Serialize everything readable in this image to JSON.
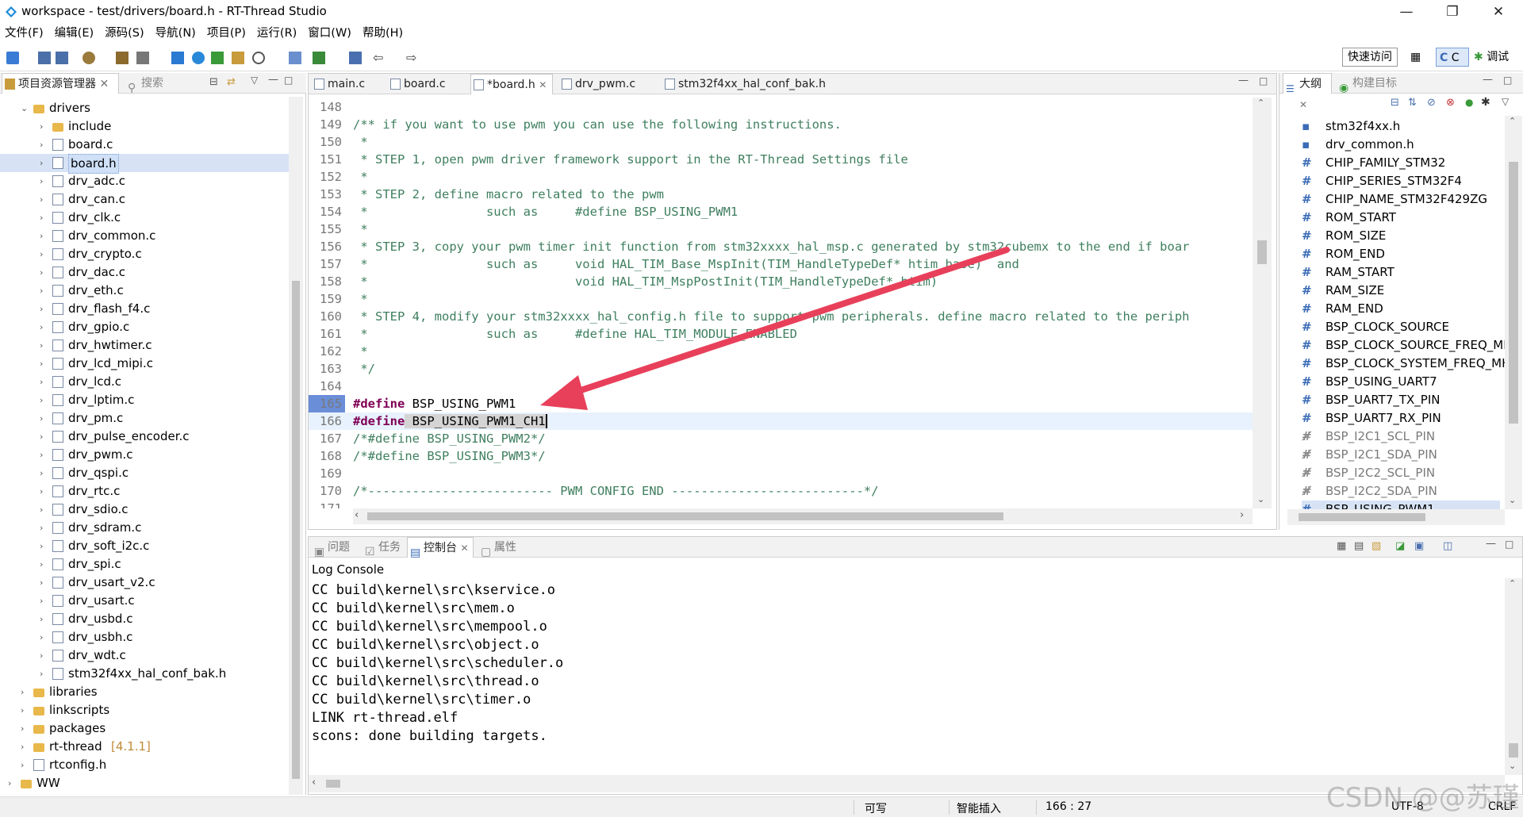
{
  "window": {
    "title": "workspace - test/drivers/board.h - RT-Thread Studio"
  },
  "menu": [
    "文件(F)",
    "编辑(E)",
    "源码(S)",
    "导航(N)",
    "项目(P)",
    "运行(R)",
    "窗口(W)",
    "帮助(H)"
  ],
  "toolbar": {
    "quick_access": "快速访问",
    "perspective_c": "C",
    "perspective_debug": "调试"
  },
  "explorer": {
    "tabs": [
      "项目资源管理器",
      "搜索"
    ],
    "items": [
      {
        "label": "drivers",
        "type": "folder",
        "expanded": true
      },
      {
        "label": "include",
        "type": "folder"
      },
      {
        "label": "board.c",
        "type": "file"
      },
      {
        "label": "board.h",
        "type": "file",
        "selected": true
      },
      {
        "label": "drv_adc.c",
        "type": "file"
      },
      {
        "label": "drv_can.c",
        "type": "file"
      },
      {
        "label": "drv_clk.c",
        "type": "file"
      },
      {
        "label": "drv_common.c",
        "type": "file"
      },
      {
        "label": "drv_crypto.c",
        "type": "file"
      },
      {
        "label": "drv_dac.c",
        "type": "file"
      },
      {
        "label": "drv_eth.c",
        "type": "file"
      },
      {
        "label": "drv_flash_f4.c",
        "type": "file"
      },
      {
        "label": "drv_gpio.c",
        "type": "file"
      },
      {
        "label": "drv_hwtimer.c",
        "type": "file"
      },
      {
        "label": "drv_lcd_mipi.c",
        "type": "file"
      },
      {
        "label": "drv_lcd.c",
        "type": "file"
      },
      {
        "label": "drv_lptim.c",
        "type": "file"
      },
      {
        "label": "drv_pm.c",
        "type": "file"
      },
      {
        "label": "drv_pulse_encoder.c",
        "type": "file"
      },
      {
        "label": "drv_pwm.c",
        "type": "file"
      },
      {
        "label": "drv_qspi.c",
        "type": "file"
      },
      {
        "label": "drv_rtc.c",
        "type": "file"
      },
      {
        "label": "drv_sdio.c",
        "type": "file"
      },
      {
        "label": "drv_sdram.c",
        "type": "file"
      },
      {
        "label": "drv_soft_i2c.c",
        "type": "file"
      },
      {
        "label": "drv_spi.c",
        "type": "file"
      },
      {
        "label": "drv_usart_v2.c",
        "type": "file"
      },
      {
        "label": "drv_usart.c",
        "type": "file"
      },
      {
        "label": "drv_usbd.c",
        "type": "file"
      },
      {
        "label": "drv_usbh.c",
        "type": "file"
      },
      {
        "label": "drv_wdt.c",
        "type": "file"
      },
      {
        "label": "stm32f4xx_hal_conf_bak.h",
        "type": "file"
      },
      {
        "label": "libraries",
        "type": "folder"
      },
      {
        "label": "linkscripts",
        "type": "folder"
      },
      {
        "label": "packages",
        "type": "folder"
      },
      {
        "label": "rt-thread",
        "type": "folder",
        "badge": "[4.1.1]"
      },
      {
        "label": "rtconfig.h",
        "type": "file"
      },
      {
        "label": "WW",
        "type": "project"
      }
    ]
  },
  "editor": {
    "tabs": [
      "main.c",
      "board.c",
      "*board.h",
      "drv_pwm.c",
      "stm32f4xx_hal_conf_bak.h"
    ],
    "active_tab": "*board.h",
    "lines": [
      {
        "n": "148",
        "t": ""
      },
      {
        "n": "149",
        "t": "/** if you want to use pwm you can use the following instructions."
      },
      {
        "n": "150",
        "t": " *"
      },
      {
        "n": "151",
        "t": " * STEP 1, open pwm driver framework support in the RT-Thread Settings file"
      },
      {
        "n": "152",
        "t": " *"
      },
      {
        "n": "153",
        "t": " * STEP 2, define macro related to the pwm"
      },
      {
        "n": "154",
        "t": " *                such as     #define BSP_USING_PWM1"
      },
      {
        "n": "155",
        "t": " *"
      },
      {
        "n": "156",
        "t": " * STEP 3, copy your pwm timer init function from stm32xxxx_hal_msp.c generated by stm32cubemx to the end if boar"
      },
      {
        "n": "157",
        "t": " *                such as     void HAL_TIM_Base_MspInit(TIM_HandleTypeDef* htim_base)  and"
      },
      {
        "n": "158",
        "t": " *                            void HAL_TIM_MspPostInit(TIM_HandleTypeDef* htim)"
      },
      {
        "n": "159",
        "t": " *"
      },
      {
        "n": "160",
        "t": " * STEP 4, modify your stm32xxxx_hal_config.h file to support pwm peripherals. define macro related to the periph"
      },
      {
        "n": "161",
        "t": " *                such as     #define HAL_TIM_MODULE_ENABLED"
      },
      {
        "n": "162",
        "t": " *"
      },
      {
        "n": "163",
        "t": " */"
      },
      {
        "n": "164",
        "t": ""
      },
      {
        "n": "165",
        "kw": "#define",
        "t": " BSP_USING_PWM1"
      },
      {
        "n": "166",
        "kw": "#define",
        "t": " BSP_USING_PWM1_CH1"
      },
      {
        "n": "167",
        "t": "/*#define BSP_USING_PWM2*/"
      },
      {
        "n": "168",
        "t": "/*#define BSP_USING_PWM3*/"
      },
      {
        "n": "169",
        "t": ""
      },
      {
        "n": "170",
        "t": "/*------------------------- PWM CONFIG END --------------------------*/"
      },
      {
        "n": "171",
        "t": ""
      }
    ]
  },
  "outline": {
    "tabs": [
      "大纲",
      "构建目标"
    ],
    "items": [
      {
        "label": "stm32f4xx.h",
        "kind": "include"
      },
      {
        "label": "drv_common.h",
        "kind": "include"
      },
      {
        "label": "CHIP_FAMILY_STM32",
        "kind": "macro"
      },
      {
        "label": "CHIP_SERIES_STM32F4",
        "kind": "macro"
      },
      {
        "label": "CHIP_NAME_STM32F429ZG",
        "kind": "macro"
      },
      {
        "label": "ROM_START",
        "kind": "macro"
      },
      {
        "label": "ROM_SIZE",
        "kind": "macro"
      },
      {
        "label": "ROM_END",
        "kind": "macro"
      },
      {
        "label": "RAM_START",
        "kind": "macro"
      },
      {
        "label": "RAM_SIZE",
        "kind": "macro"
      },
      {
        "label": "RAM_END",
        "kind": "macro"
      },
      {
        "label": "BSP_CLOCK_SOURCE",
        "kind": "macro"
      },
      {
        "label": "BSP_CLOCK_SOURCE_FREQ_MH",
        "kind": "macro"
      },
      {
        "label": "BSP_CLOCK_SYSTEM_FREQ_MH",
        "kind": "macro"
      },
      {
        "label": "BSP_USING_UART7",
        "kind": "macro"
      },
      {
        "label": "BSP_UART7_TX_PIN",
        "kind": "macro"
      },
      {
        "label": "BSP_UART7_RX_PIN",
        "kind": "macro"
      },
      {
        "label": "BSP_I2C1_SCL_PIN",
        "kind": "disabled"
      },
      {
        "label": "BSP_I2C1_SDA_PIN",
        "kind": "disabled"
      },
      {
        "label": "BSP_I2C2_SCL_PIN",
        "kind": "disabled"
      },
      {
        "label": "BSP_I2C2_SDA_PIN",
        "kind": "disabled"
      },
      {
        "label": "BSP_USING_PWM1",
        "kind": "macro",
        "selected": true
      }
    ]
  },
  "console": {
    "tabs": [
      "问题",
      "任务",
      "控制台",
      "属性"
    ],
    "header": "Log Console",
    "lines": [
      "CC build\\kernel\\src\\kservice.o",
      "CC build\\kernel\\src\\mem.o",
      "CC build\\kernel\\src\\mempool.o",
      "CC build\\kernel\\src\\object.o",
      "CC build\\kernel\\src\\scheduler.o",
      "CC build\\kernel\\src\\thread.o",
      "CC build\\kernel\\src\\timer.o",
      "LINK rt-thread.elf",
      "scons: done building targets."
    ]
  },
  "status": {
    "writable": "可写",
    "insert_mode": "智能插入",
    "position": "166 : 27",
    "encoding": "UTF-8",
    "line_ending": "CRLF"
  },
  "watermark": "CSDN @@苏瑾",
  "colors": {
    "accent": "#3a6bb6",
    "arrow": "#e8405a"
  }
}
